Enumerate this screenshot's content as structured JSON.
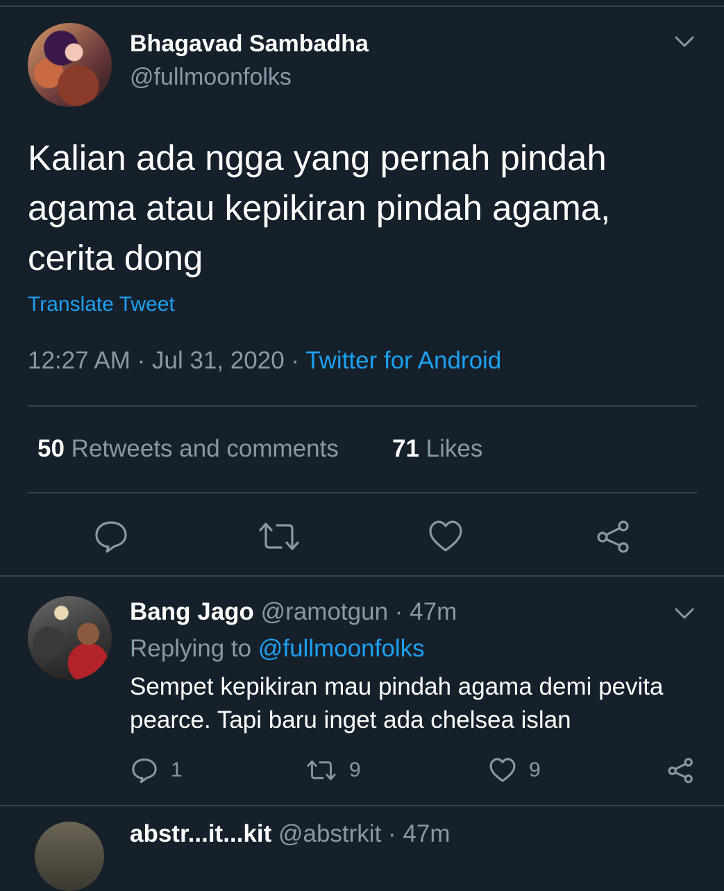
{
  "main_tweet": {
    "author_name": "Bhagavad Sambadha",
    "author_handle": "@fullmoonfolks",
    "text": "Kalian ada ngga yang pernah pindah agama atau kepikiran pindah agama, cerita dong",
    "translate_label": "Translate Tweet",
    "time": "12:27 AM",
    "separator_1": " · ",
    "date": "Jul 31, 2020",
    "separator_2": " · ",
    "source": "Twitter for Android",
    "retweets_count": "50",
    "retweets_label": " Retweets and comments",
    "likes_count": "71",
    "likes_label": " Likes"
  },
  "reply": {
    "author_name": "Bang Jago",
    "author_handle": " @ramotgun",
    "separator": " · ",
    "age": "47m",
    "replying_prefix": "Replying to ",
    "replying_to": "@fullmoonfolks",
    "text": "Sempet kepikiran mau pindah agama demi pevita pearce. Tapi baru inget ada chelsea islan",
    "reply_count": "1",
    "retweet_count": "9",
    "like_count": "9"
  },
  "next_tweet": {
    "author_name": "abstr...it...kit",
    "author_handle": " @abstrkit",
    "separator": " · ",
    "age": "47m"
  },
  "colors": {
    "background": "#15202b",
    "divider": "#38444d",
    "secondary_text": "#8899a6",
    "link": "#1da1f2"
  },
  "icons": [
    "chevron-down-icon",
    "reply-icon",
    "retweet-icon",
    "like-icon",
    "share-icon"
  ]
}
